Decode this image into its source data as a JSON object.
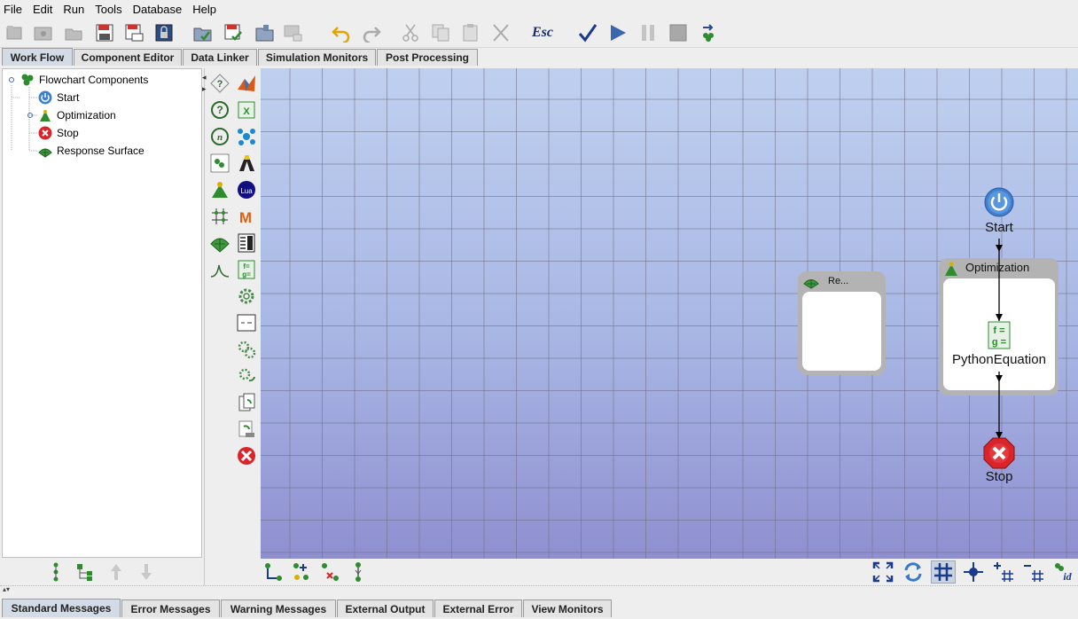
{
  "menu": [
    "File",
    "Edit",
    "Run",
    "Tools",
    "Database",
    "Help"
  ],
  "toolbar": {
    "esc_label": "Esc",
    "icons": [
      "new-icon",
      "open-icon",
      "folder-icon",
      "save-icon",
      "save-as-icon",
      "lock-icon",
      "open-workflow-icon",
      "save-workflow-icon",
      "folder-workflow-icon",
      "monitor-icon",
      "undo-icon",
      "redo-icon",
      "cut-icon",
      "copy-icon",
      "paste-icon",
      "delete-icon",
      "escape-icon",
      "check-icon",
      "run-icon",
      "pause-icon",
      "stop-icon",
      "export-icon"
    ]
  },
  "main_tabs": [
    "Work Flow",
    "Component Editor",
    "Data Linker",
    "Simulation Monitors",
    "Post Processing"
  ],
  "active_main_tab": "Work Flow",
  "tree": {
    "root": "Flowchart Components",
    "items": [
      "Start",
      "Optimization",
      "Stop",
      "Response Surface"
    ]
  },
  "canvas": {
    "start_label": "Start",
    "optimization_title": "Optimization",
    "python_label": "PythonEquation",
    "stop_label": "Stop",
    "response_title": "Re..."
  },
  "bottom_tabs": [
    "Standard Messages",
    "Error Messages",
    "Warning Messages",
    "External Output",
    "External Error",
    "View Monitors"
  ],
  "active_bottom_tab": "Standard Messages",
  "colors": {
    "start_blue": "#3f7fd0",
    "stop_red": "#d9252a",
    "green_icon": "#2e8b2e",
    "tab_active": "#d3dbe6"
  }
}
